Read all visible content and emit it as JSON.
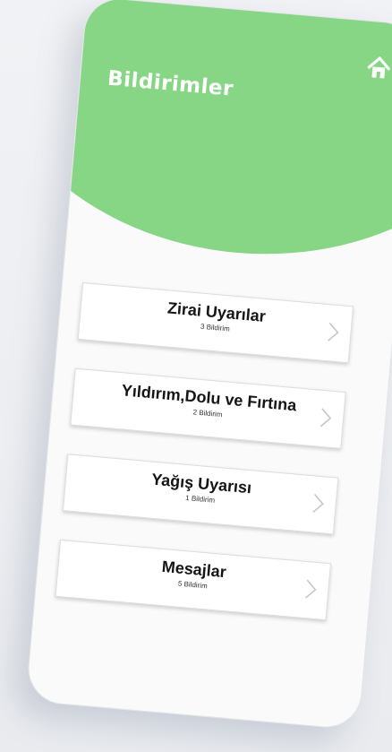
{
  "header": {
    "title": "Bildirimler",
    "home_icon": "home-icon",
    "accent": "#86d685"
  },
  "categories": [
    {
      "label": "Zirai Uyarılar",
      "count": "3 Bildirim"
    },
    {
      "label": "Yıldırım,Dolu ve Fırtına",
      "count": "2 Bildirim"
    },
    {
      "label": "Yağış Uyarısı",
      "count": "1 Bildirim"
    },
    {
      "label": "Mesajlar",
      "count": "5 Bildirim"
    }
  ]
}
